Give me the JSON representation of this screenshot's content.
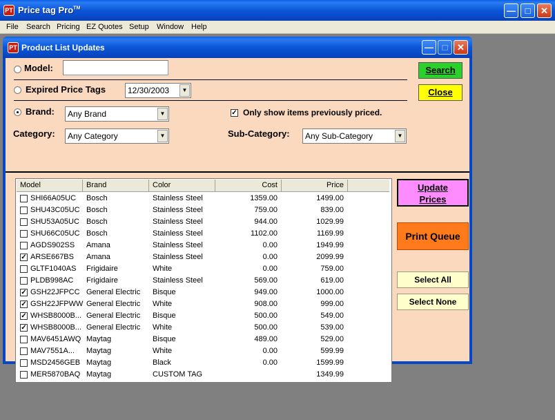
{
  "app": {
    "title": "Price tag Pro",
    "tm": "TM",
    "icon_label": "PT"
  },
  "menu": [
    "File",
    "Search",
    "Pricing",
    "EZ Quotes",
    "Setup",
    "Window",
    "Help"
  ],
  "window": {
    "title": "Product List Updates"
  },
  "filters": {
    "model_label": "Model:",
    "model_value": "",
    "expired_label": "Expired Price Tags",
    "expired_date": "12/30/2003",
    "brand_label": "Brand:",
    "brand_value": "Any Brand",
    "only_priced_label": "Only show items previously priced.",
    "only_priced_checked": true,
    "category_label": "Category:",
    "category_value": "Any Category",
    "subcategory_label": "Sub-Category:",
    "subcategory_value": "Any Sub-Category",
    "selected_radio": "brand"
  },
  "buttons": {
    "search": "Search",
    "close": "Close",
    "update_line1": "Update",
    "update_line2": "Prices",
    "print_queue": "Print Queue",
    "select_all": "Select All",
    "select_none": "Select None"
  },
  "table": {
    "columns": [
      "Model",
      "Brand",
      "Color",
      "Cost",
      "Price"
    ],
    "rows": [
      {
        "checked": false,
        "model": "SHI66A05UC",
        "brand": "Bosch",
        "color": "Stainless Steel",
        "cost": "1359.00",
        "price": "1499.00"
      },
      {
        "checked": false,
        "model": "SHU43C05UC",
        "brand": "Bosch",
        "color": "Stainless Steel",
        "cost": "759.00",
        "price": "839.00"
      },
      {
        "checked": false,
        "model": "SHU53A05UC",
        "brand": "Bosch",
        "color": "Stainless Steel",
        "cost": "944.00",
        "price": "1029.99"
      },
      {
        "checked": false,
        "model": "SHU66C05UC",
        "brand": "Bosch",
        "color": "Stainless Steel",
        "cost": "1102.00",
        "price": "1169.99"
      },
      {
        "checked": false,
        "model": "AGDS902SS",
        "brand": "Amana",
        "color": "Stainless Steel",
        "cost": "0.00",
        "price": "1949.99"
      },
      {
        "checked": true,
        "model": "ARSE667BS",
        "brand": "Amana",
        "color": "Stainless Steel",
        "cost": "0.00",
        "price": "2099.99"
      },
      {
        "checked": false,
        "model": "GLTF1040AS",
        "brand": "Frigidaire",
        "color": "White",
        "cost": "0.00",
        "price": "759.00"
      },
      {
        "checked": false,
        "model": "PLDB998AC",
        "brand": "Frigidaire",
        "color": "Stainless Steel",
        "cost": "569.00",
        "price": "619.00"
      },
      {
        "checked": true,
        "model": "GSH22JFPCC",
        "brand": "General Electric",
        "color": "Bisque",
        "cost": "949.00",
        "price": "1000.00"
      },
      {
        "checked": true,
        "model": "GSH22JFPWW",
        "brand": "General Electric",
        "color": "White",
        "cost": "908.00",
        "price": "999.00"
      },
      {
        "checked": true,
        "model": "WHSB8000B...",
        "brand": "General Electric",
        "color": "Bisque",
        "cost": "500.00",
        "price": "549.00"
      },
      {
        "checked": true,
        "model": "WHSB8000B...",
        "brand": "General Electric",
        "color": "White",
        "cost": "500.00",
        "price": "539.00"
      },
      {
        "checked": false,
        "model": "MAV6451AWQ",
        "brand": "Maytag",
        "color": "Bisque",
        "cost": "489.00",
        "price": "529.00"
      },
      {
        "checked": false,
        "model": "MAV7551A...",
        "brand": "Maytag",
        "color": "White",
        "cost": "0.00",
        "price": "599.99"
      },
      {
        "checked": false,
        "model": "MSD2456GEB",
        "brand": "Maytag",
        "color": "Black",
        "cost": "0.00",
        "price": "1599.99"
      },
      {
        "checked": false,
        "model": "MER5870BAQ",
        "brand": "Maytag",
        "color": "CUSTOM TAG",
        "cost": "",
        "price": "1349.99"
      }
    ]
  }
}
